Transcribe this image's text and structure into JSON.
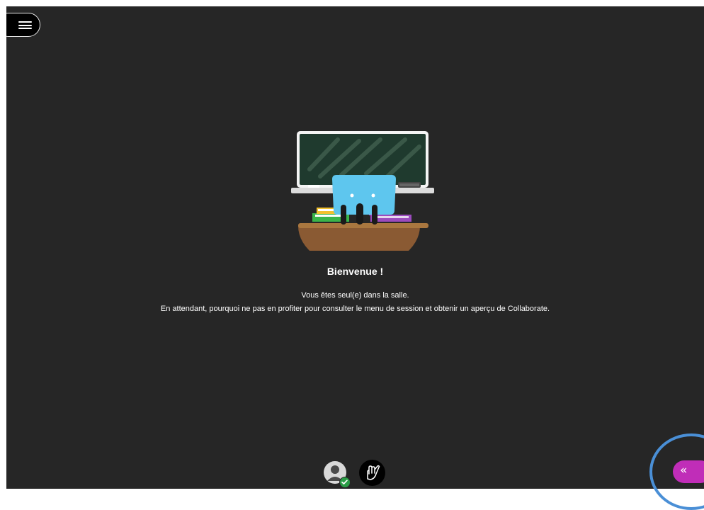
{
  "app": {
    "menu_button": {
      "icon": "hamburger-icon"
    }
  },
  "welcome": {
    "title": "Bienvenue !",
    "line1": "Vous êtes seul(e) dans la salle.",
    "line2": "En attendant, pourquoi ne pas en profiter pour consulter le menu de session et obtenir un aperçu de Collaborate."
  },
  "controls": {
    "avatar_icon": "user-avatar-icon",
    "status_icon": "checkmark-icon",
    "raise_hand_icon": "raise-hand-icon",
    "panel_toggle_label": "«"
  },
  "colors": {
    "stage_bg": "#262626",
    "accent": "#c02db8",
    "status_ok": "#2a9d46",
    "highlight": "#4a8fd6"
  }
}
